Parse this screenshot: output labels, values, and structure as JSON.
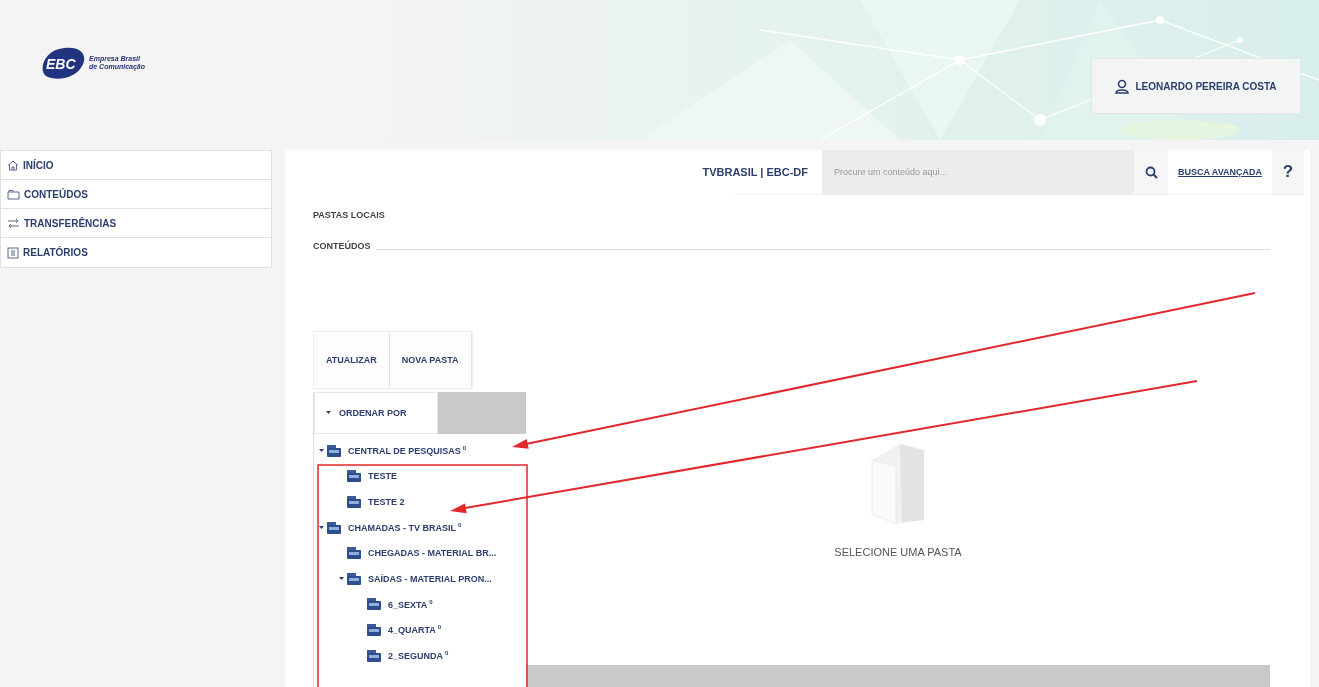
{
  "header": {
    "logo": {
      "mark": "EBC",
      "line1": "Empresa Brasil",
      "line2": "de Comunicação"
    },
    "user": {
      "name": "LEONARDO PEREIRA COSTA"
    }
  },
  "sidebar": {
    "items": [
      {
        "label": "INÍCIO",
        "kind": "home"
      },
      {
        "label": "CONTEÚDOS",
        "kind": "folder"
      },
      {
        "label": "TRANSFERÊNCIAS",
        "kind": "transfer"
      },
      {
        "label": "RELATÓRIOS",
        "kind": "report"
      }
    ]
  },
  "topbar": {
    "site": "TVBRASIL | EBC-DF",
    "search": {
      "placeholder": "Procure um conteúdo aqui..."
    },
    "advanced_search": "BUSCA AVANÇADA",
    "help": "?"
  },
  "sections": [
    "PASTAS LOCAIS",
    "CONTEÚDOS"
  ],
  "buttons": [
    "ATUALIZAR",
    "NOVA PASTA"
  ],
  "sort": {
    "label": "ORDENAR POR",
    "expanded": true
  },
  "tree": [
    {
      "label": "CENTRAL DE PESQUISAS",
      "count": "0",
      "expanded": true,
      "children": [
        {
          "label": "TESTE",
          "expanded": false
        },
        {
          "label": "TESTE 2",
          "expanded": false
        }
      ]
    },
    {
      "label": "CHAMADAS - TV BRASIL",
      "count": "0",
      "expanded": true,
      "children": [
        {
          "label": "CHEGADAS - MATERIAL BR...",
          "expanded": false
        },
        {
          "label": "SAÍDAS - MATERIAL PRON...",
          "expanded": true,
          "children": [
            {
              "label": "6_SEXTA",
              "count": "0",
              "expanded": false
            },
            {
              "label": "4_QUARTA",
              "count": "0",
              "expanded": false
            },
            {
              "label": "2_SEGUNDA",
              "count": "0",
              "expanded": false
            }
          ]
        }
      ]
    }
  ],
  "empty_state": {
    "message": "SELECIONE UMA PASTA"
  }
}
